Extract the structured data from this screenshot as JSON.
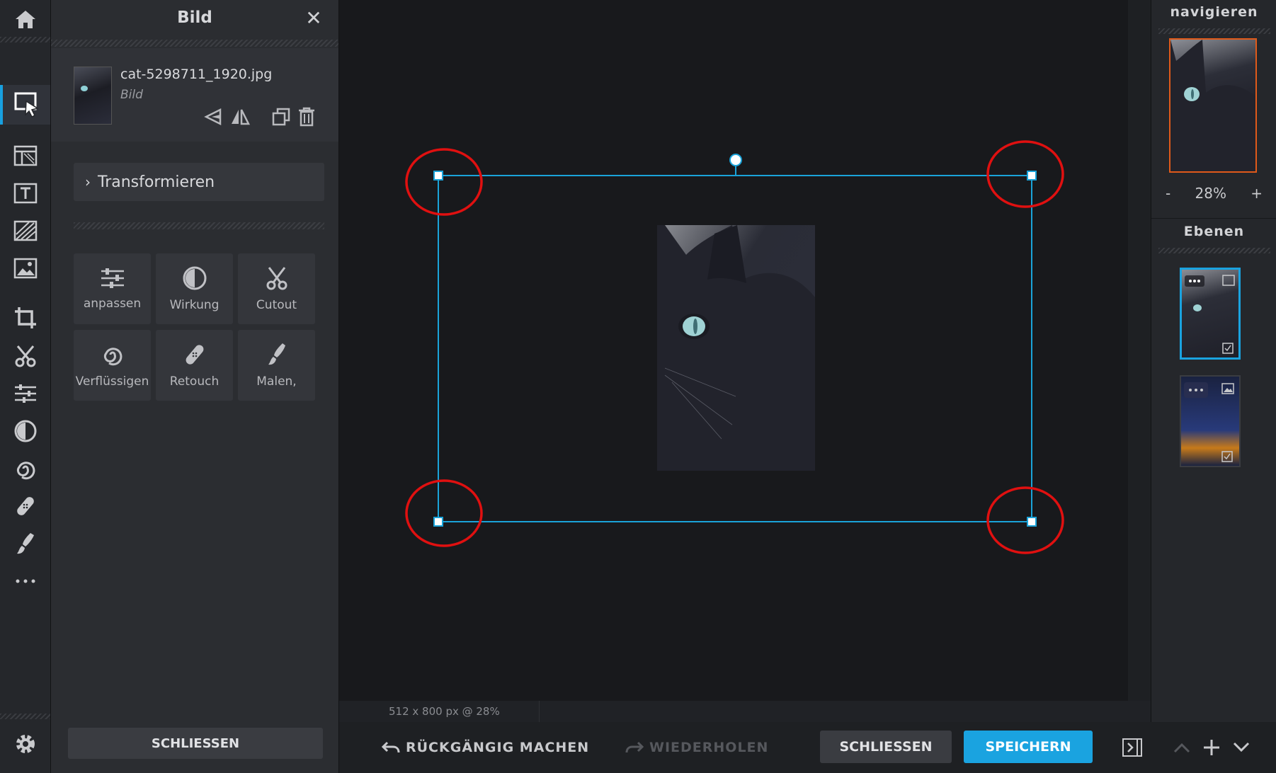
{
  "toolbar": {
    "tools": [
      {
        "icon": "home-icon"
      },
      {
        "icon": "arrange-tool-icon",
        "active": true
      },
      {
        "icon": "templates-icon"
      },
      {
        "icon": "text-tool-icon"
      },
      {
        "icon": "pattern-icon"
      },
      {
        "icon": "image-icon"
      },
      {
        "icon": "crop-icon"
      },
      {
        "icon": "cutout-icon"
      },
      {
        "icon": "adjust-icon"
      },
      {
        "icon": "effect-icon"
      },
      {
        "icon": "liquify-icon"
      },
      {
        "icon": "retouch-icon"
      },
      {
        "icon": "paint-icon"
      },
      {
        "icon": "more-icon"
      },
      {
        "icon": "settings-icon"
      }
    ]
  },
  "panel": {
    "title": "Bild",
    "close_glyph": "✕",
    "layer": {
      "file_name": "cat-5298711_1920.jpg",
      "type_label": "Bild"
    },
    "transform_label": "Transformieren",
    "tiles": [
      {
        "label": "anpassen",
        "icon": "sliders-icon"
      },
      {
        "label": "Wirkung",
        "icon": "contrast-icon"
      },
      {
        "label": "Cutout",
        "icon": "scissors-icon"
      },
      {
        "label": "Verflüssigen",
        "icon": "swirl-icon"
      },
      {
        "label": "Retouch",
        "icon": "bandage-icon"
      },
      {
        "label": "Malen,",
        "icon": "brush-icon"
      }
    ],
    "close_button": "SCHLIESSEN"
  },
  "canvas": {
    "status": "512 x 800 px @ 28%",
    "selection_color": "#1aa3d9",
    "highlight_color": "#e01010"
  },
  "bottom": {
    "undo": "RÜCKGÄNGIG MACHEN",
    "redo": "WIEDERHOLEN",
    "close": "SCHLIESSEN",
    "save": "SPEICHERN",
    "accent": "#1aa3e0"
  },
  "right": {
    "navigate_title": "navigieren",
    "zoom_minus": "-",
    "zoom_value": "28%",
    "zoom_plus": "+",
    "layers_title": "Ebenen"
  }
}
